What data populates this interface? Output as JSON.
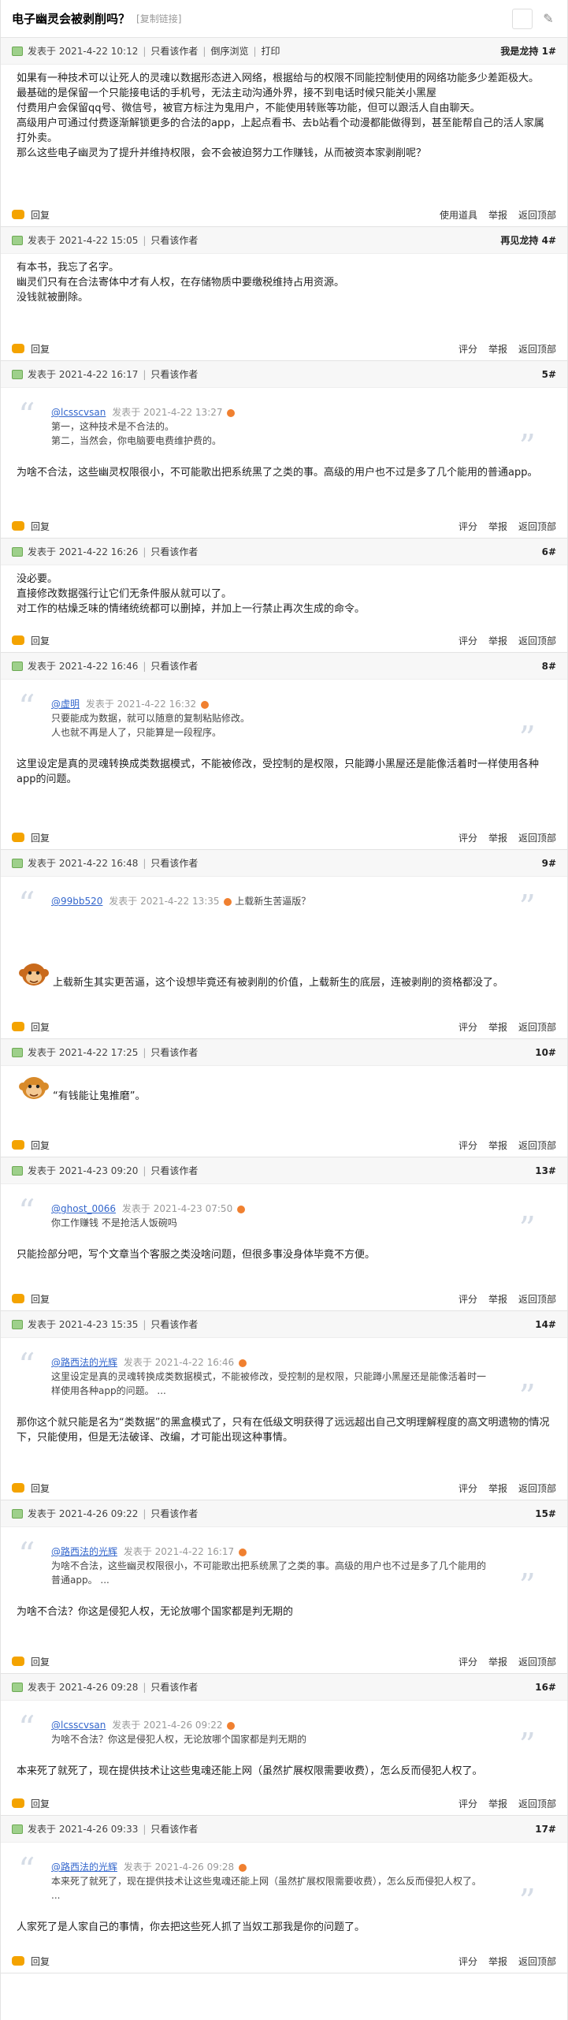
{
  "header": {
    "title": "电子幽灵会被剥削吗？",
    "copy": "[复制链接]"
  },
  "meta": {
    "posted": "发表于",
    "only": "只看该作者",
    "reverse": "倒序浏览",
    "print": "打印"
  },
  "foot": {
    "reply": "回复",
    "comment": "评分",
    "report": "举报",
    "top": "返回顶部",
    "use": "使用道具"
  },
  "posts": [
    {
      "date": "2021-4-22 10:12",
      "floor": "我是龙持",
      "fn": "1#",
      "body": [
        "如果有一种技术可以让死人的灵魂以数据形态进入网络，根据给与的权限不同能控制使用的网络功能多少差距极大。",
        "最基础的是保留一个只能接电话的手机号，无法主动沟通外界，接不到电话时候只能关小黑屋",
        "付费用户会保留qq号、微信号，被官方标注为鬼用户，不能使用转账等功能，但可以跟活人自由聊天。",
        "高级用户可通过付费逐渐解锁更多的合法的app，上起点看书、去b站看个动漫都能做得到，甚至能帮自己的活人家属打外卖。",
        "那么这些电子幽灵为了提升并维持权限，会不会被迫努力工作赚钱，从而被资本家剥削呢？"
      ]
    },
    {
      "date": "2021-4-22 15:05",
      "floor": "再见龙持",
      "fn": "4#",
      "body": [
        "有本书，我忘了名字。",
        "幽灵们只有在合法寄体中才有人权，在存储物质中要缴税维持占用资源。",
        "没钱就被删除。"
      ]
    },
    {
      "date": "2021-4-22 16:17",
      "fn": "5#",
      "quote": {
        "user": "@lcsscvsan",
        "time": "发表于 2021-4-22 13:27",
        "lines": [
          "第一，这种技术是不合法的。",
          "第二，当然会，你电脑要电费维护费的。"
        ]
      },
      "body": [
        "为啥不合法，这些幽灵权限很小，不可能歌出把系统黑了之类的事。高级的用户也不过是多了几个能用的普通app。"
      ]
    },
    {
      "date": "2021-4-22 16:26",
      "fn": "6#",
      "body": [
        "没必要。",
        "直接修改数据强行让它们无条件服从就可以了。",
        "对工作的枯燥乏味的情绪统统都可以删掉，并加上一行禁止再次生成的命令。"
      ]
    },
    {
      "date": "2021-4-22 16:46",
      "fn": "8#",
      "quote": {
        "user": "@虚明",
        "time": "发表于 2021-4-22 16:32",
        "lines": [
          "只要能成为数据，就可以随意的复制粘贴修改。",
          "人也就不再是人了，只能算是一段程序。"
        ]
      },
      "body": [
        "这里设定是真的灵魂转换成类数据模式，不能被修改，受控制的是权限，只能蹲小黑屋还是能像活着时一样使用各种app的问题。"
      ]
    },
    {
      "date": "2021-4-22 16:48",
      "fn": "9#",
      "quote": {
        "user": "@99bb520",
        "time": "发表于 2021-4-22 13:35",
        "lines": [
          "上载新生苦逼版？"
        ],
        "inline": true
      },
      "emoji": "monkey1",
      "body": [
        "上载新生其实更苦逼，这个设想毕竟还有被剥削的价值，上载新生的底层，连被剥削的资格都没了。"
      ]
    },
    {
      "date": "2021-4-22 17:25",
      "fn": "10#",
      "emoji": "monkey2",
      "body": [
        "“有钱能让鬼推磨”。"
      ]
    },
    {
      "date": "2021-4-23 09:20",
      "fn": "13#",
      "quote": {
        "user": "@ghost_0066",
        "time": "发表于 2021-4-23 07:50",
        "lines": [
          "你工作赚钱  不是抢活人饭碗吗"
        ]
      },
      "body": [
        "只能捡部分吧，写个文章当个客服之类没啥问题，但很多事没身体毕竟不方便。"
      ]
    },
    {
      "date": "2021-4-23 15:35",
      "fn": "14#",
      "quote": {
        "user": "@路西法的光辉",
        "time": "发表于 2021-4-22 16:46",
        "lines": [
          "这里设定是真的灵魂转换成类数据模式，不能被修改，受控制的是权限，只能蹲小黑屋还是能像活着时一样使用各种app的问题。 ..."
        ]
      },
      "body": [
        "那你这个就只能是名为“类数据”的黑盒模式了，只有在低级文明获得了远远超出自己文明理解程度的高文明遗物的情况下，只能使用，但是无法破译、改编，才可能出现这种事情。"
      ]
    },
    {
      "date": "2021-4-26 09:22",
      "fn": "15#",
      "quote": {
        "user": "@路西法的光辉",
        "time": "发表于 2021-4-22 16:17",
        "lines": [
          "为啥不合法，这些幽灵权限很小，不可能歌出把系统黑了之类的事。高级的用户也不过是多了几个能用的普通app。 ..."
        ]
      },
      "body": [
        "为啥不合法？你这是侵犯人权，无论放哪个国家都是判无期的"
      ]
    },
    {
      "date": "2021-4-26 09:28",
      "fn": "16#",
      "quote": {
        "user": "@lcsscvsan",
        "time": "发表于 2021-4-26 09:22",
        "lines": [
          "为啥不合法？你这是侵犯人权，无论放哪个国家都是判无期的"
        ]
      },
      "body": [
        "本来死了就死了，现在提供技术让这些鬼魂还能上网（虽然扩展权限需要收费），怎么反而侵犯人权了。"
      ]
    },
    {
      "date": "2021-4-26 09:33",
      "fn": "17#",
      "quote": {
        "user": "@路西法的光辉",
        "time": "发表于 2021-4-26 09:28",
        "lines": [
          "本来死了就死了，现在提供技术让这些鬼魂还能上网（虽然扩展权限需要收费），怎么反而侵犯人权了。 ..."
        ]
      },
      "body": [
        "人家死了是人家自己的事情，你去把这些死人抓了当奴工那我是你的问题了。"
      ]
    }
  ]
}
